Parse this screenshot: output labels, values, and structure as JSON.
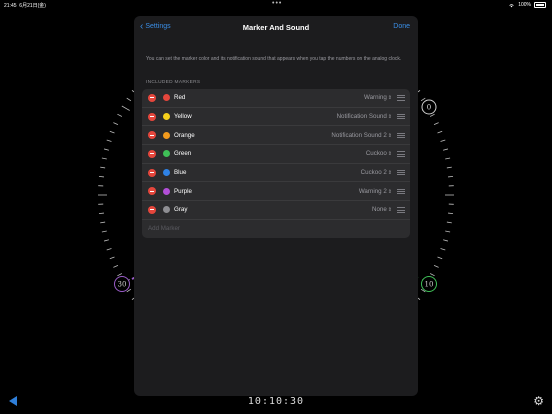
{
  "status": {
    "time": "21:45",
    "date": "6月21日(金)",
    "battery": "100%"
  },
  "sheet": {
    "back_label": "Settings",
    "title": "Marker And Sound",
    "done_label": "Done",
    "description": "You can set the marker color and its notification sound that appears when you tap the numbers on the analog clock.",
    "section_header": "INCLUDED MARKERS",
    "markers": [
      {
        "name": "Red",
        "color": "#e5463c",
        "sound": "Warning"
      },
      {
        "name": "Yellow",
        "color": "#f5cf1b",
        "sound": "Notification Sound"
      },
      {
        "name": "Orange",
        "color": "#f29a1d",
        "sound": "Notification Sound 2"
      },
      {
        "name": "Green",
        "color": "#3fbf57",
        "sound": "Cuckoo"
      },
      {
        "name": "Blue",
        "color": "#2f82e6",
        "sound": "Cuckoo 2"
      },
      {
        "name": "Purple",
        "color": "#b34fd8",
        "sound": "Warning 2"
      },
      {
        "name": "Gray",
        "color": "#8e8e93",
        "sound": "None"
      }
    ],
    "add_placeholder": "Add Marker"
  },
  "clock": {
    "labels": [
      "0",
      "30",
      "10"
    ]
  },
  "bottom": {
    "time": "10:10:30"
  }
}
